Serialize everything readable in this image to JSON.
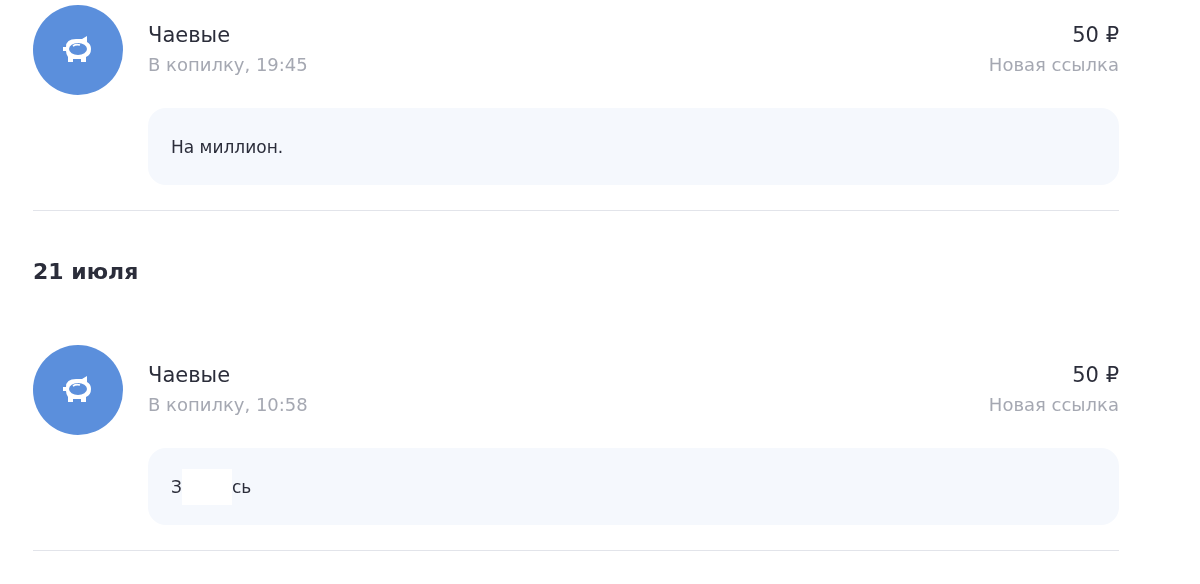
{
  "feed": [
    {
      "kind": "transaction",
      "title": "Чаевые",
      "subtitle": "В копилку, 19:45",
      "amount": "50 ₽",
      "status": "Новая ссылка",
      "comment": {
        "kind": "plain",
        "text": "На миллион."
      }
    },
    {
      "kind": "date",
      "text": "21 июля"
    },
    {
      "kind": "transaction",
      "title": "Чаевые",
      "subtitle": "В копилку, 10:58",
      "amount": "50 ₽",
      "status": "Новая ссылка",
      "comment": {
        "kind": "redacted",
        "before": "З",
        "after": "сь"
      }
    }
  ]
}
